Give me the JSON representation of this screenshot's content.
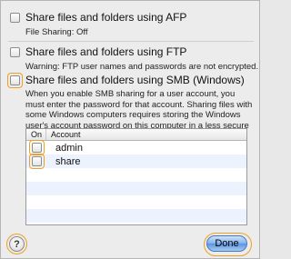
{
  "afp": {
    "label": "Share files and folders using AFP",
    "status": "File Sharing: Off",
    "checked": false
  },
  "ftp": {
    "label": "Share files and folders using FTP",
    "warning": "Warning: FTP user names and passwords are not encrypted.",
    "checked": false
  },
  "smb": {
    "label": "Share files and folders using SMB (Windows)",
    "description": "When you enable SMB sharing for a user account, you must enter the password for that account. Sharing files with some Windows computers requires storing the Windows user's account password on this computer in a less secure manner.",
    "checked": false
  },
  "accounts_table": {
    "columns": [
      "On",
      "Account"
    ],
    "rows": [
      {
        "on": false,
        "account": "admin"
      },
      {
        "on": false,
        "account": "share"
      }
    ]
  },
  "footer": {
    "help_label": "?",
    "done_label": "Done"
  },
  "colors": {
    "highlight": "#f0a020",
    "done_button": "#5b93df",
    "alt_row": "#edf3fe"
  }
}
